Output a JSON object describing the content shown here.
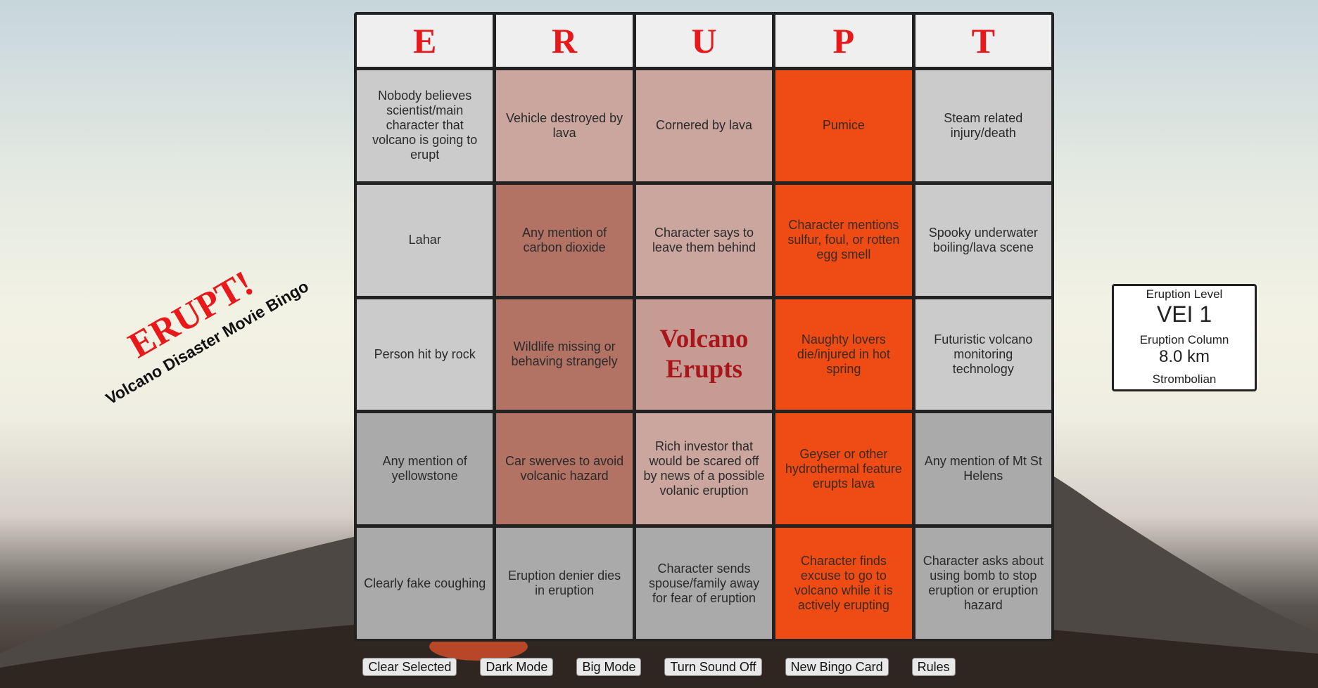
{
  "title": {
    "main": "ERUPT!",
    "subtitle": "Volcano Disaster Movie Bingo"
  },
  "board": {
    "headers": [
      "E",
      "R",
      "U",
      "P",
      "T"
    ],
    "rows": [
      [
        "Nobody believes scientist/main character that volcano is going to erupt",
        "Vehicle destroyed by lava",
        "Cornered by lava",
        "Pumice",
        "Steam related injury/death"
      ],
      [
        "Lahar",
        "Any mention of carbon dioxide",
        "Character says to leave them behind",
        "Character mentions sulfur, foul, or rotten egg smell",
        "Spooky underwater boiling/lava scene"
      ],
      [
        "Person hit by rock",
        "Wildlife missing or behaving strangely",
        "Volcano Erupts",
        "Naughty lovers die/injured in hot spring",
        "Futuristic volcano monitoring technology"
      ],
      [
        "Any mention of yellowstone",
        "Car swerves to avoid volcanic hazard",
        "Rich investor that would be scared off by news of a possible volanic eruption",
        "Geyser or other hydrothermal feature erupts lava",
        "Any mention of Mt St Helens"
      ],
      [
        "Clearly fake coughing",
        "Eruption denier dies in eruption",
        "Character sends spouse/family away for fear of eruption",
        "Character finds excuse to go to volcano while it is actively erupting",
        "Character asks about using bomb to stop eruption or eruption hazard"
      ]
    ],
    "selected_column": "P"
  },
  "status": {
    "level_label": "Eruption Level",
    "level_value": "VEI 1",
    "column_label": "Eruption Column",
    "column_value": "8.0 km",
    "type": "Strombolian"
  },
  "buttons": {
    "clear": "Clear Selected",
    "dark": "Dark Mode",
    "big": "Big Mode",
    "sound": "Turn Sound Off",
    "new_card": "New Bingo Card",
    "rules": "Rules"
  },
  "colors": {
    "accent": "#e8181b",
    "selected": "#ff5014",
    "free_text": "#a8151a"
  }
}
